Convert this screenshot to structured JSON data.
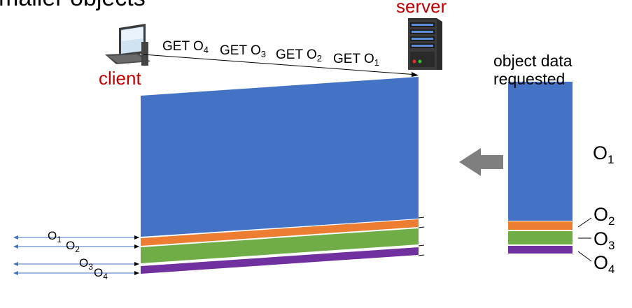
{
  "title_fragment": "maller objects",
  "labels": {
    "server": "server",
    "client": "client",
    "legend_title_line1": "object data",
    "legend_title_line2": "requested"
  },
  "requests": [
    {
      "prefix": "GET O",
      "sub": "4"
    },
    {
      "prefix": "GET O",
      "sub": "3"
    },
    {
      "prefix": "GET O",
      "sub": "2"
    },
    {
      "prefix": "GET O",
      "sub": "1"
    }
  ],
  "objects": [
    {
      "base": "O",
      "sub": "1",
      "color": "#4472c4",
      "share": 0.88
    },
    {
      "base": "O",
      "sub": "2",
      "color": "#ed7d31",
      "share": 0.05
    },
    {
      "base": "O",
      "sub": "3",
      "color": "#70ad47",
      "share": 0.09
    },
    {
      "base": "O",
      "sub": "4",
      "color": "#7030a0",
      "share": 0.045
    }
  ],
  "arrival_labels": [
    {
      "base": "O",
      "sub": "1"
    },
    {
      "base": "O",
      "sub": "2"
    },
    {
      "base": "O",
      "sub": "3"
    },
    {
      "base": "O",
      "sub": "4"
    }
  ],
  "colors": {
    "arrow": "#7f7f7f",
    "client_arrow": "#4472c4",
    "label_red": "#c00000"
  },
  "icons": {
    "client": "desktop-computer-icon",
    "server": "server-tower-icon",
    "flow": "left-arrow-icon"
  }
}
